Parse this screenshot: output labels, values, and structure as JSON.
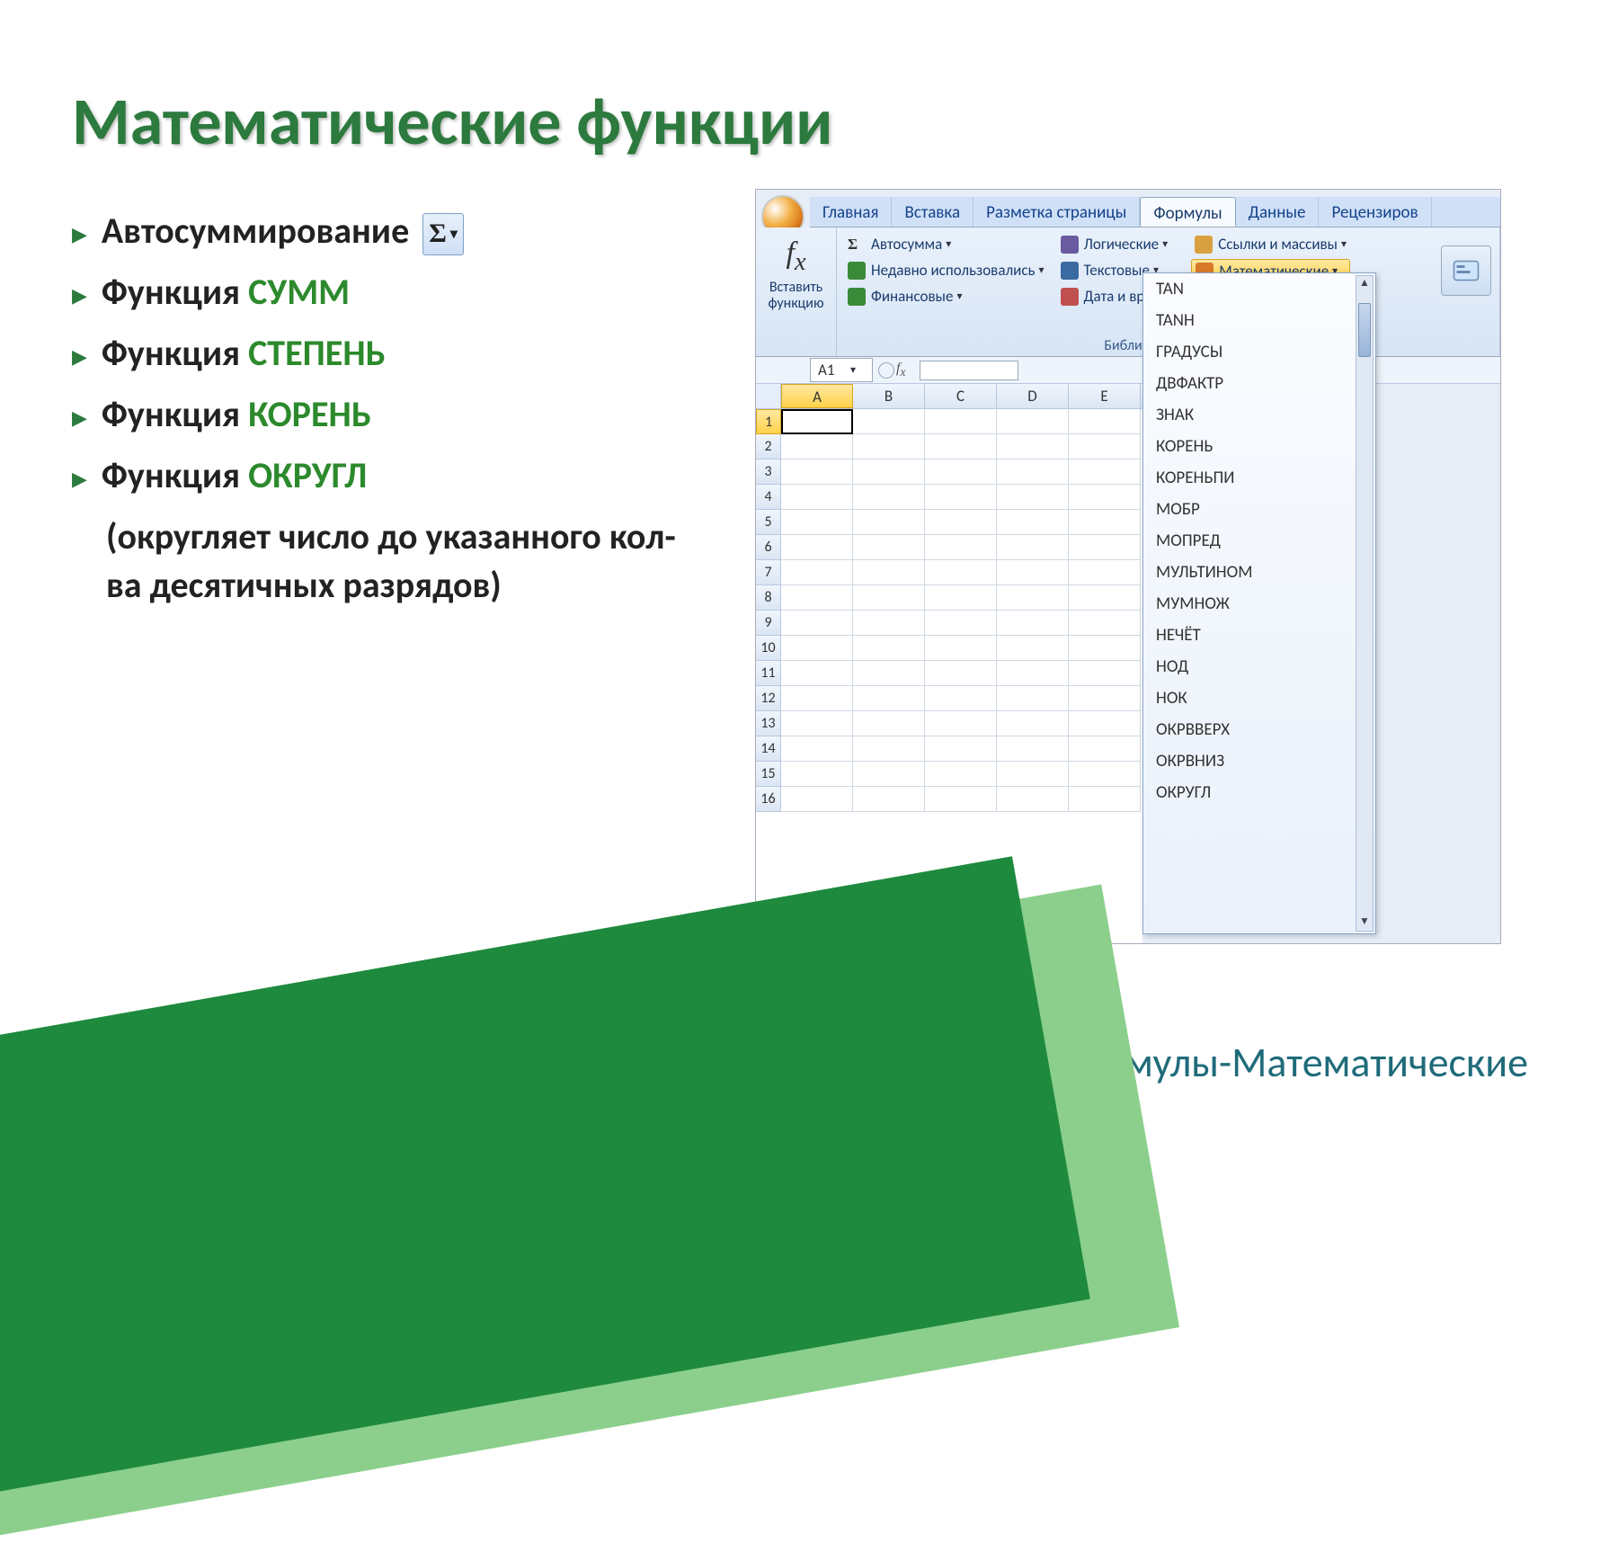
{
  "title": "Математические функции",
  "bullets": {
    "b1_text": "Автосуммирование",
    "sigma": "Σ",
    "b2_prefix": "Функция ",
    "b2_func": "СУММ",
    "b3_prefix": "Функция ",
    "b3_func": "СТЕПЕНЬ",
    "b4_prefix": "Функция ",
    "b4_func": "КОРЕНЬ",
    "b5_prefix": "Функция ",
    "b5_func": "ОКРУГЛ",
    "b5_sub": "(округляет число до указанного кол-ва десятичных разрядов)"
  },
  "footer": "Меню-Формулы-Математические",
  "excel": {
    "tabs": [
      "Главная",
      "Вставка",
      "Разметка страницы",
      "Формулы",
      "Данные",
      "Рецензиров"
    ],
    "active_tab": "Формулы",
    "ribbon": {
      "insert_fn_line1": "Вставить",
      "insert_fn_line2": "функцию",
      "group_caption": "Библиотека функций",
      "col1": [
        "Автосумма",
        "Недавно использовались",
        "Финансовые"
      ],
      "col2": [
        "Логические",
        "Текстовые",
        "Дата и время"
      ],
      "col3": [
        "Ссылки и массивы",
        "Математические"
      ]
    },
    "namebox": "A1",
    "columns": [
      "A",
      "B",
      "C",
      "D",
      "E"
    ],
    "rows": [
      "1",
      "2",
      "3",
      "4",
      "5",
      "6",
      "7",
      "8",
      "9",
      "10",
      "11",
      "12",
      "13",
      "14",
      "15",
      "16"
    ],
    "menu_items": [
      "TAN",
      "TANH",
      "ГРАДУСЫ",
      "ДВФАКТР",
      "ЗНАК",
      "КОРЕНЬ",
      "КОРЕНЬПИ",
      "МОБР",
      "МОПРЕД",
      "МУЛЬТИНОМ",
      "МУМНОЖ",
      "НЕЧЁТ",
      "НОД",
      "НОК",
      "ОКРВВЕРХ",
      "ОКРВНИЗ",
      "ОКРУГЛ"
    ]
  }
}
